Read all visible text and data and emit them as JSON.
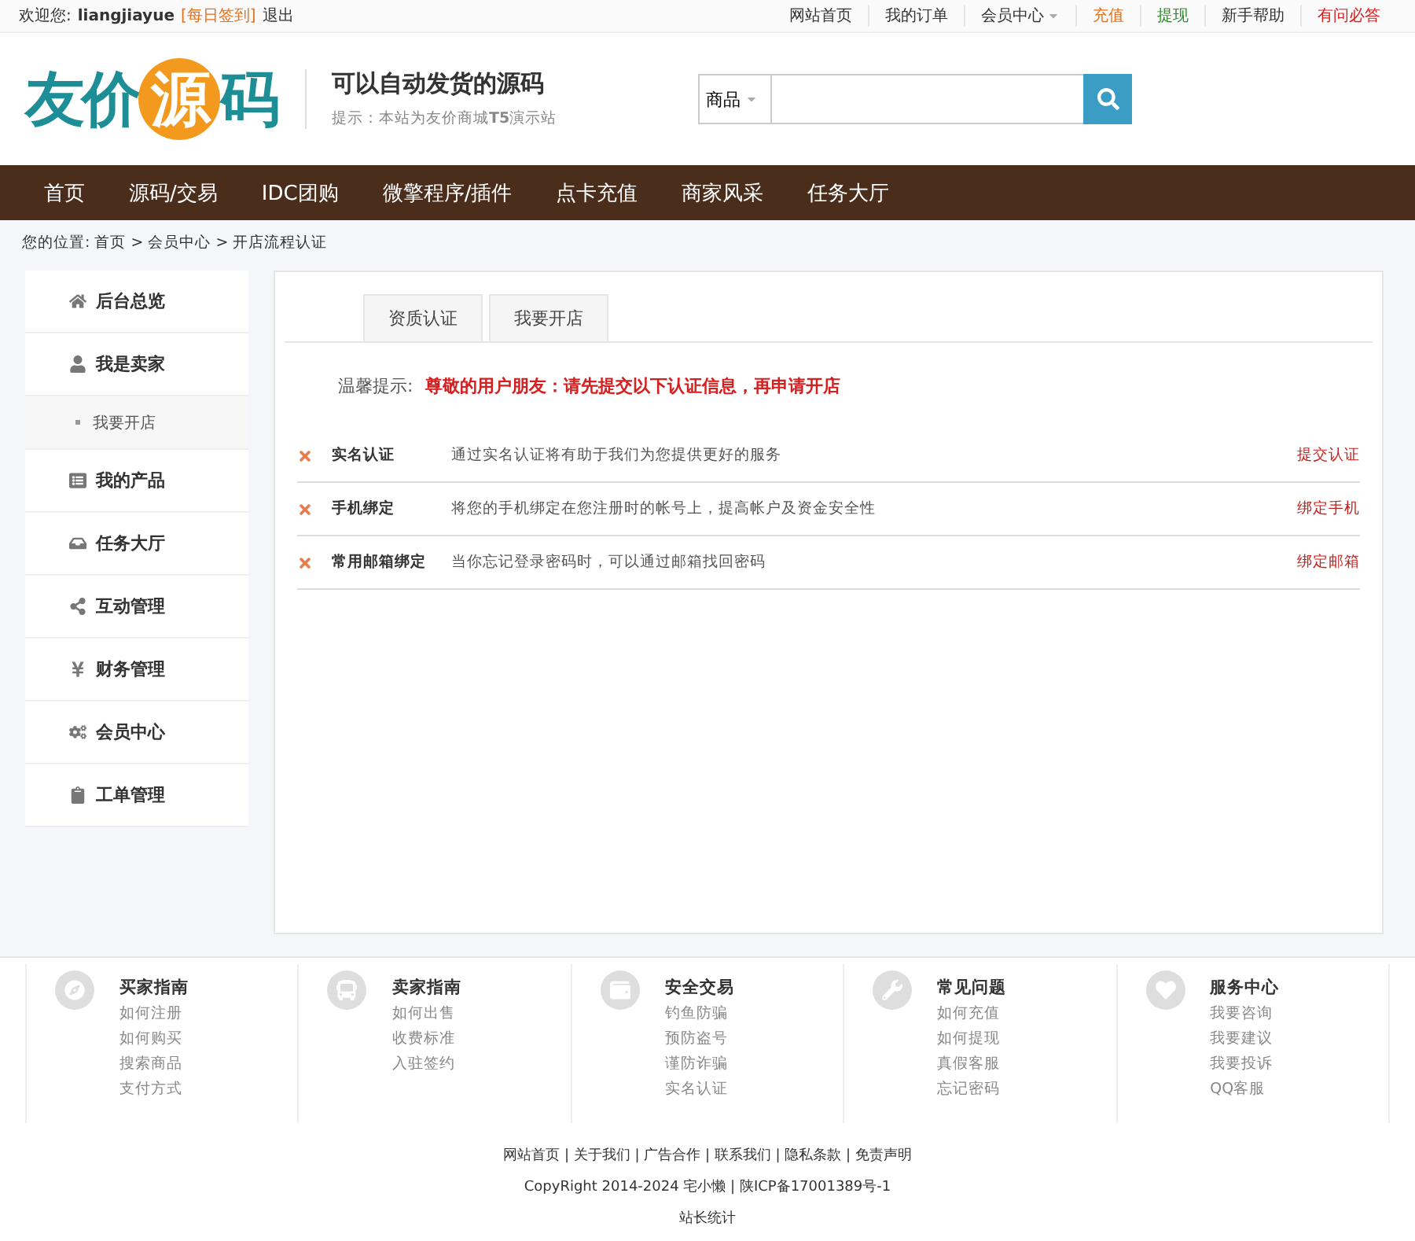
{
  "top_bar": {
    "welcome": "欢迎您:",
    "username": "liangjiayue",
    "checkin": "[每日签到]",
    "logout": "退出",
    "links": [
      {
        "label": "网站首页",
        "color": "#333333",
        "dropdown": false
      },
      {
        "label": "我的订单",
        "color": "#333333",
        "dropdown": false
      },
      {
        "label": "会员中心",
        "color": "#333333",
        "dropdown": true
      },
      {
        "label": "充值",
        "color": "#e8701a",
        "dropdown": false
      },
      {
        "label": "提现",
        "color": "#2e8b2e",
        "dropdown": false
      },
      {
        "label": "新手帮助",
        "color": "#333333",
        "dropdown": false
      },
      {
        "label": "有问必答",
        "color": "#d42020",
        "dropdown": false
      }
    ]
  },
  "header": {
    "logo": [
      {
        "text": "友价",
        "kind": "plain"
      },
      {
        "text": "源",
        "kind": "circle"
      },
      {
        "text": "码",
        "kind": "plain"
      }
    ],
    "slogan": "可以自动发货的源码",
    "tip": "提示：本站为友价商城**T5**演示站",
    "search": {
      "category": "商品"
    }
  },
  "nav": [
    "首页",
    "源码/交易",
    "IDC团购",
    "微擎程序/插件",
    "点卡充值",
    "商家风采",
    "任务大厅"
  ],
  "breadcrumb": {
    "label": "您的位置:",
    "path": "首页 > 会员中心 > 开店流程认证"
  },
  "sidebar": [
    {
      "label": "后台总览"
    },
    {
      "label": "我是卖家",
      "children": [
        {
          "label": "我要开店"
        }
      ]
    },
    {
      "label": "我的产品"
    },
    {
      "label": "任务大厅"
    },
    {
      "label": "互动管理"
    },
    {
      "label": "财务管理"
    },
    {
      "label": "会员中心"
    },
    {
      "label": "工单管理"
    }
  ],
  "tabs": [
    "资质认证",
    "我要开店"
  ],
  "notice": {
    "label": "温馨提示:",
    "message": "尊敬的用户朋友：请先提交以下认证信息，再申请开店"
  },
  "verifications": [
    {
      "title": "实名认证",
      "description": "通过实名认证将有助于我们为您提供更好的服务",
      "action": "提交认证",
      "done": false
    },
    {
      "title": "手机绑定",
      "description": "将您的手机绑定在您注册时的帐号上，提高帐户及资金安全性",
      "action": "绑定手机",
      "done": false
    },
    {
      "title": "常用邮箱绑定",
      "description": "当你忘记登录密码时，可以通过邮箱找回密码",
      "action": "绑定邮箱",
      "done": false
    }
  ],
  "footer_columns": [
    {
      "title": "买家指南",
      "links": [
        "如何注册",
        "如何购买",
        "搜索商品",
        "支付方式"
      ]
    },
    {
      "title": "卖家指南",
      "links": [
        "如何出售",
        "收费标准",
        "入驻签约"
      ]
    },
    {
      "title": "安全交易",
      "links": [
        "钓鱼防骗",
        "预防盗号",
        "谨防诈骗",
        "实名认证"
      ]
    },
    {
      "title": "常见问题",
      "links": [
        "如何充值",
        "如何提现",
        "真假客服",
        "忘记密码"
      ]
    },
    {
      "title": "服务中心",
      "links": [
        "我要咨询",
        "我要建议",
        "我要投诉",
        "QQ客服"
      ]
    }
  ],
  "bottom_links": "网站首页 | 关于我们 | 广告合作 | 联系我们 | 隐私条款 | 免责声明",
  "copyright": "CopyRight 2014-2024 宅小懒 | 陕ICP备17001389号-1",
  "stats": "站长统计"
}
